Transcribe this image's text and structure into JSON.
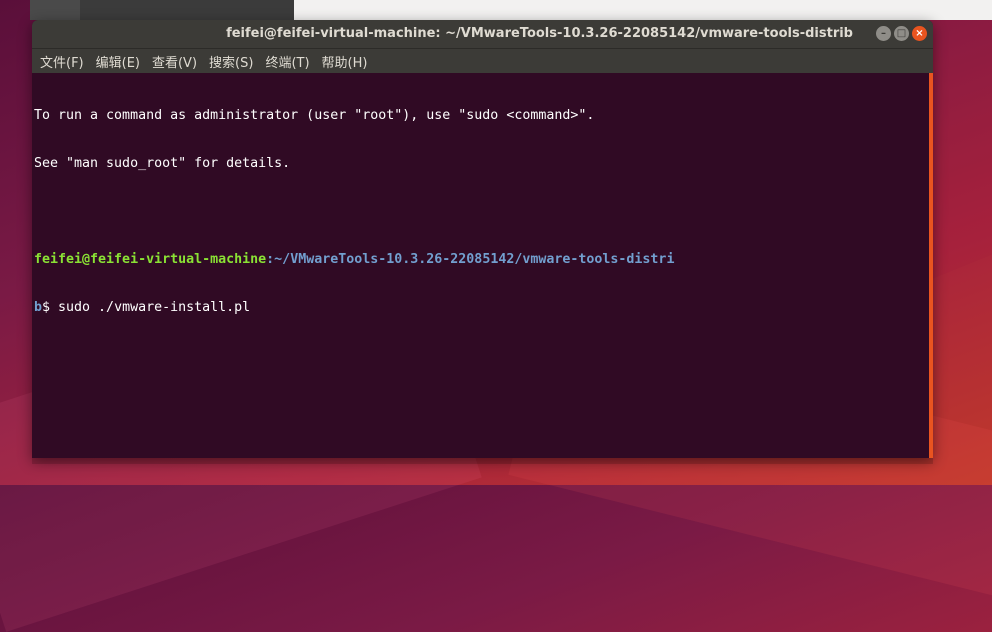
{
  "window": {
    "title": "feifei@feifei-virtual-machine: ~/VMwareTools-10.3.26-22085142/vmware-tools-distrib",
    "controls": {
      "minimize_icon": "minimize-icon",
      "maximize_icon": "maximize-icon",
      "close_icon": "close-icon"
    }
  },
  "menubar": {
    "items": [
      {
        "label": "文件(F)"
      },
      {
        "label": "编辑(E)"
      },
      {
        "label": "查看(V)"
      },
      {
        "label": "搜索(S)"
      },
      {
        "label": "终端(T)"
      },
      {
        "label": "帮助(H)"
      }
    ]
  },
  "terminal": {
    "intro_line_1": "To run a command as administrator (user \"root\"), use \"sudo <command>\".",
    "intro_line_2": "See \"man sudo_root\" for details.",
    "prompt_user": "feifei@feifei-virtual-machine",
    "prompt_path_part1": ":~/VMwareTools-10.3.26-22085142/vmware-tools-distri",
    "prompt_path_part2": "b",
    "prompt_suffix": "$ sudo ./vmware-install.pl"
  },
  "colors": {
    "terminal_bg": "#300a24",
    "prompt_user": "#8ae234",
    "prompt_path": "#729fcf",
    "accent": "#e95420"
  }
}
